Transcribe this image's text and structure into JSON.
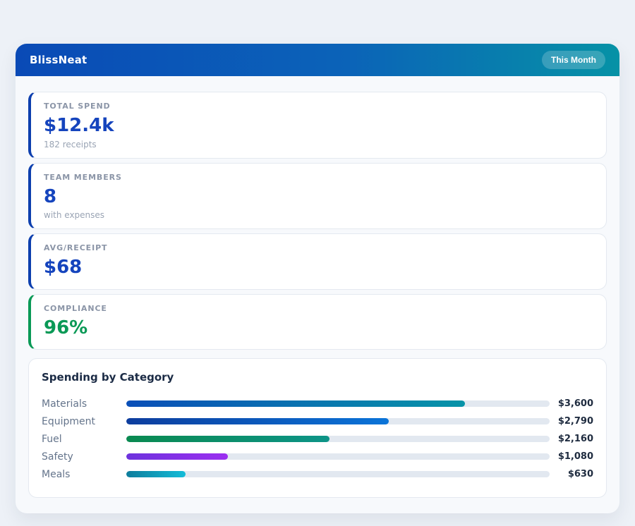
{
  "page": {
    "background": "#edf1f7"
  },
  "header": {
    "app_name": "BlissNeat",
    "period_badge": "This Month",
    "gradient_from": "#0a4ab6",
    "gradient_to": "#0692a6"
  },
  "stats": [
    {
      "label": "TOTAL SPEND",
      "value": "$12.4k",
      "sub": "182 receipts",
      "accent": "#0d3fae",
      "value_color": "#1544bd"
    },
    {
      "label": "TEAM MEMBERS",
      "value": "8",
      "sub": "with expenses",
      "accent": "#0d3fae",
      "value_color": "#1544bd"
    },
    {
      "label": "AVG/RECEIPT",
      "value": "$68",
      "sub": "",
      "accent": "#0d3fae",
      "value_color": "#1544bd"
    },
    {
      "label": "COMPLIANCE",
      "value": "96%",
      "sub": "",
      "accent": "#0a9956",
      "value_color": "#0a9956"
    }
  ],
  "chart_data": {
    "type": "bar",
    "title": "Spending by Category",
    "categories": [
      "Materials",
      "Equipment",
      "Fuel",
      "Safety",
      "Meals"
    ],
    "values": [
      3600,
      2790,
      2160,
      1080,
      630
    ],
    "value_labels": [
      "$3,600",
      "$2,790",
      "$2,160",
      "$1,080",
      "$630"
    ],
    "axis_max": 4500,
    "track_color": "#e2e8f0",
    "bar_gradients": [
      [
        "#0b4fb8",
        "#0894a8"
      ],
      [
        "#0d3d9e",
        "#0b74d8"
      ],
      [
        "#0a8a50",
        "#0d9488"
      ],
      [
        "#6d32dd",
        "#9b2ff0"
      ],
      [
        "#0e7d9c",
        "#14bcd8"
      ]
    ]
  }
}
